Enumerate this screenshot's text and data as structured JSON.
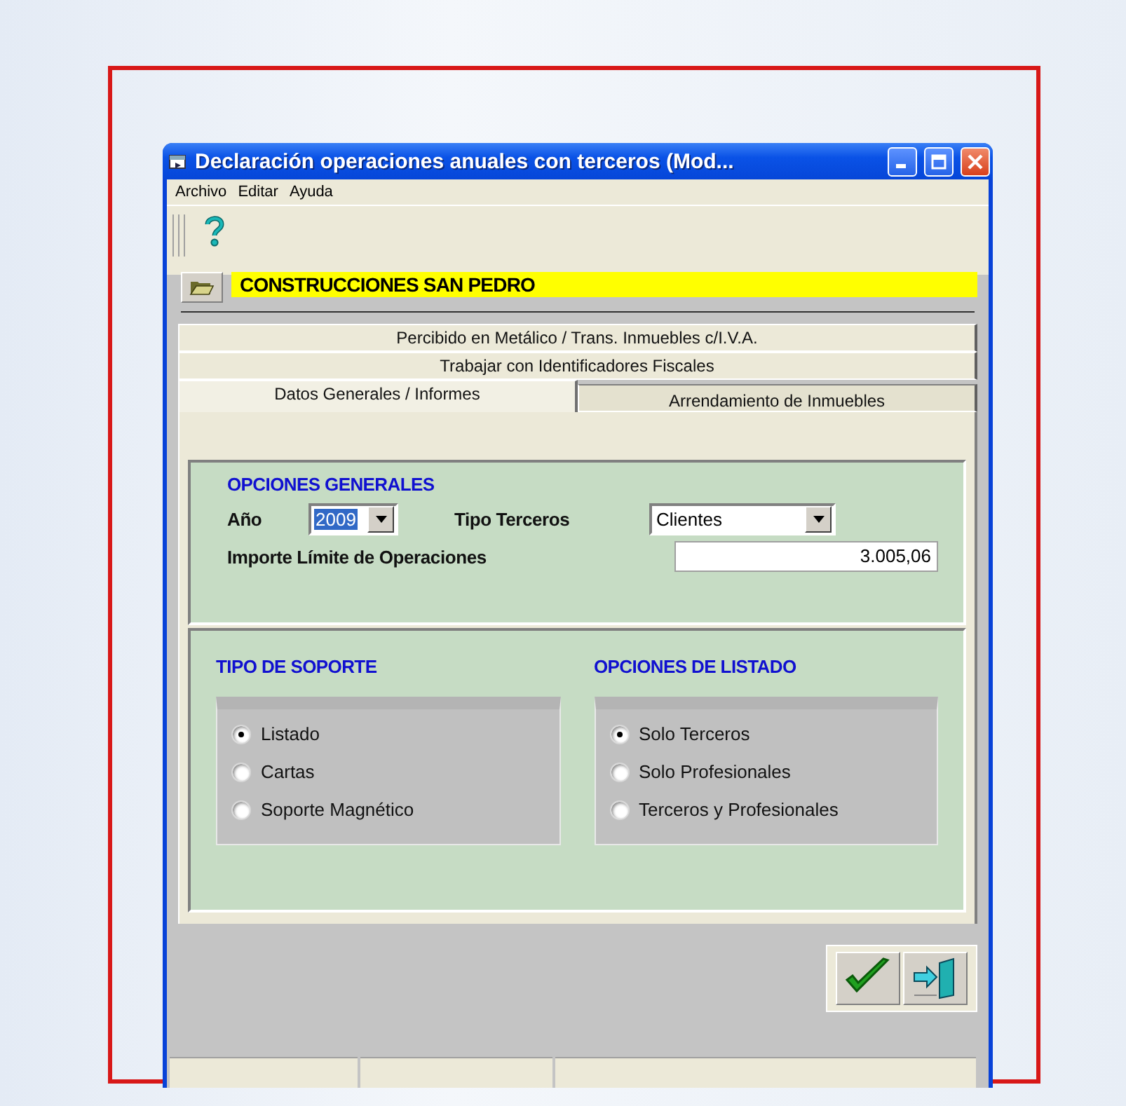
{
  "window": {
    "title": "Declaración operaciones anuales con terceros (Mod..."
  },
  "menu": [
    "Archivo",
    "Editar",
    "Ayuda"
  ],
  "company": {
    "name": "CONSTRUCCIONES SAN PEDRO"
  },
  "tab_rows": [
    {
      "tabs": [
        {
          "label": "Percibido en Metálico / Trans. Inmuebles c/I.V.A.",
          "selected": false
        }
      ]
    },
    {
      "tabs": [
        {
          "label": "Trabajar con Identificadores Fiscales",
          "selected": false
        }
      ]
    },
    {
      "tabs": [
        {
          "label": "Datos Generales / Informes",
          "selected": true
        },
        {
          "label": "Arrendamiento de Inmuebles",
          "selected": false
        }
      ]
    }
  ],
  "general_options": {
    "heading": "OPCIONES GENERALES",
    "year": {
      "label": "Año",
      "value": "2009"
    },
    "third_party_type": {
      "label": "Tipo Terceros",
      "value": "Clientes"
    },
    "limit": {
      "label": "Importe Límite de Operaciones",
      "value": "3.005,06"
    }
  },
  "groups": [
    {
      "heading": "TIPO DE SOPORTE",
      "options": [
        {
          "label": "Listado",
          "selected": true
        },
        {
          "label": "Cartas",
          "selected": false
        },
        {
          "label": "Soporte Magnético",
          "selected": false
        }
      ]
    },
    {
      "heading": "OPCIONES DE LISTADO",
      "options": [
        {
          "label": "Solo Terceros",
          "selected": true
        },
        {
          "label": "Solo Profesionales",
          "selected": false
        },
        {
          "label": "Terceros y Profesionales",
          "selected": false
        }
      ]
    }
  ]
}
